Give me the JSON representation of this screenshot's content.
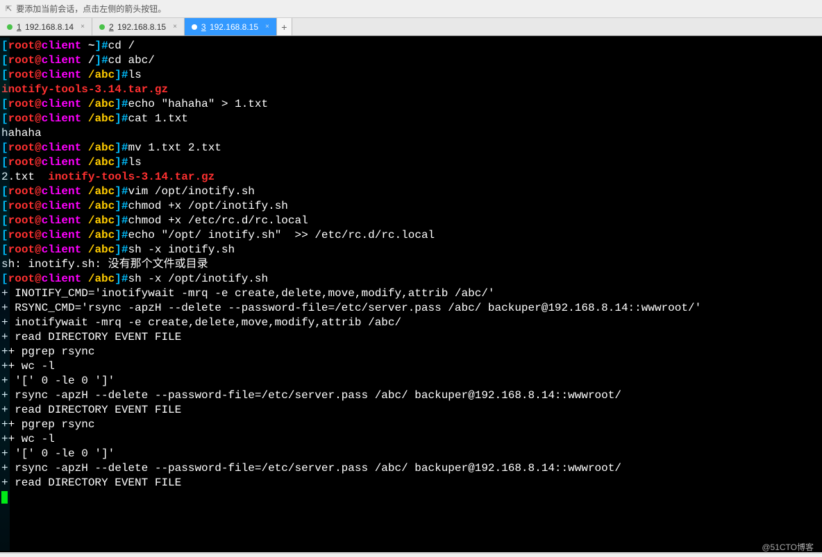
{
  "topbar": {
    "hint": "要添加当前会话，点击左侧的箭头按钮。"
  },
  "tabs": [
    {
      "num": "1",
      "label": "192.168.8.14",
      "active": false
    },
    {
      "num": "2",
      "label": "192.168.8.15",
      "active": false
    },
    {
      "num": "3",
      "label": "192.168.8.15",
      "active": true
    }
  ],
  "add_tab": "+",
  "prompt": {
    "user": "root",
    "host": "client"
  },
  "lines": [
    {
      "type": "prompt",
      "path": "~",
      "cmd": "cd /"
    },
    {
      "type": "prompt",
      "path": "/",
      "cmd": "cd abc/"
    },
    {
      "type": "prompt",
      "path": "/abc",
      "cmd": "ls"
    },
    {
      "type": "redfile",
      "text": "inotify-tools-3.14.tar.gz"
    },
    {
      "type": "prompt",
      "path": "/abc",
      "cmd": "echo \"hahaha\" > 1.txt"
    },
    {
      "type": "prompt",
      "path": "/abc",
      "cmd": "cat 1.txt"
    },
    {
      "type": "out",
      "text": "hahaha"
    },
    {
      "type": "prompt",
      "path": "/abc",
      "cmd": "mv 1.txt 2.txt"
    },
    {
      "type": "prompt",
      "path": "/abc",
      "cmd": "ls"
    },
    {
      "type": "ls2",
      "a": "2.txt  ",
      "b": "inotify-tools-3.14.tar.gz"
    },
    {
      "type": "prompt",
      "path": "/abc",
      "cmd": "vim /opt/inotify.sh"
    },
    {
      "type": "prompt",
      "path": "/abc",
      "cmd": "chmod +x /opt/inotify.sh"
    },
    {
      "type": "prompt",
      "path": "/abc",
      "cmd": "chmod +x /etc/rc.d/rc.local"
    },
    {
      "type": "prompt",
      "path": "/abc",
      "cmd": "echo \"/opt/ inotify.sh\"  >> /etc/rc.d/rc.local"
    },
    {
      "type": "prompt",
      "path": "/abc",
      "cmd": "sh -x inotify.sh"
    },
    {
      "type": "out",
      "text": "sh: inotify.sh: 没有那个文件或目录"
    },
    {
      "type": "prompt",
      "path": "/abc",
      "cmd": "sh -x /opt/inotify.sh"
    },
    {
      "type": "out",
      "text": "+ INOTIFY_CMD='inotifywait -mrq -e create,delete,move,modify,attrib /abc/'"
    },
    {
      "type": "out",
      "text": "+ RSYNC_CMD='rsync -apzH --delete --password-file=/etc/server.pass /abc/ backuper@192.168.8.14::wwwroot/'"
    },
    {
      "type": "out",
      "text": "+ inotifywait -mrq -e create,delete,move,modify,attrib /abc/"
    },
    {
      "type": "out",
      "text": "+ read DIRECTORY EVENT FILE"
    },
    {
      "type": "out",
      "text": "++ pgrep rsync"
    },
    {
      "type": "out",
      "text": "++ wc -l"
    },
    {
      "type": "out",
      "text": "+ '[' 0 -le 0 ']'"
    },
    {
      "type": "out",
      "text": "+ rsync -apzH --delete --password-file=/etc/server.pass /abc/ backuper@192.168.8.14::wwwroot/"
    },
    {
      "type": "out",
      "text": "+ read DIRECTORY EVENT FILE"
    },
    {
      "type": "out",
      "text": "++ pgrep rsync"
    },
    {
      "type": "out",
      "text": "++ wc -l"
    },
    {
      "type": "out",
      "text": "+ '[' 0 -le 0 ']'"
    },
    {
      "type": "out",
      "text": "+ rsync -apzH --delete --password-file=/etc/server.pass /abc/ backuper@192.168.8.14::wwwroot/"
    },
    {
      "type": "out",
      "text": "+ read DIRECTORY EVENT FILE"
    }
  ],
  "watermark": "@51CTO博客"
}
